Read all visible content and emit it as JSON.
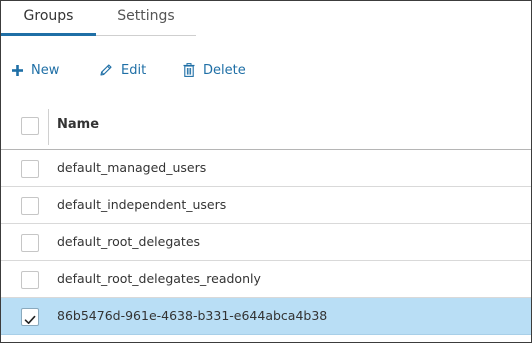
{
  "tabs": [
    {
      "label": "Groups",
      "active": true
    },
    {
      "label": "Settings",
      "active": false
    }
  ],
  "toolbar": {
    "new_label": "New",
    "edit_label": "Edit",
    "delete_label": "Delete",
    "accent_color": "#1f6fa6"
  },
  "table": {
    "columns": [
      "Name"
    ],
    "rows": [
      {
        "name": "default_managed_users",
        "checked": false
      },
      {
        "name": "default_independent_users",
        "checked": false
      },
      {
        "name": "default_root_delegates",
        "checked": false
      },
      {
        "name": "default_root_delegates_readonly",
        "checked": false
      },
      {
        "name": "86b5476d-961e-4638-b331-e644abca4b38",
        "checked": true
      }
    ],
    "selected_row_color": "#b9def5"
  },
  "icons": {
    "new": "plus-icon",
    "edit": "pencil-icon",
    "delete": "trash-icon",
    "check": "checkmark-icon"
  }
}
